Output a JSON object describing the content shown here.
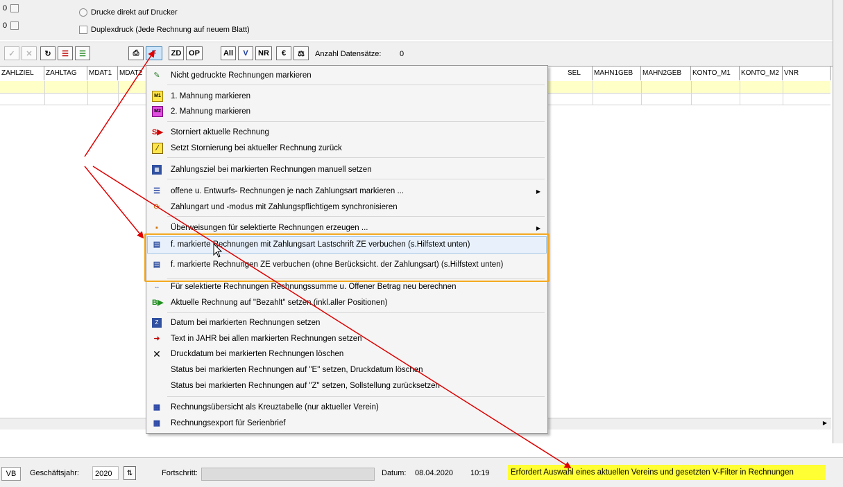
{
  "options": {
    "row1_num": "0",
    "row2_num": "0",
    "print_direct": "Drucke direkt auf Drucker",
    "duplex": "Duplexdruck (Jede Rechnung auf neuem Blatt)"
  },
  "toolbar": {
    "zd": "ZD",
    "op": "OP",
    "all": "All",
    "v": "V",
    "nr": "NR",
    "count_label": "Anzahl Datensätze:",
    "count_value": "0"
  },
  "grid": {
    "columns_left": [
      "ZAHLZIEL",
      "ZAHLTAG",
      "MDAT1",
      "MDAT2"
    ],
    "columns_right": [
      "SEL",
      "MAHN1GEB",
      "MAHN2GEB",
      "KONTO_M1",
      "KONTO_M2",
      "VNR"
    ]
  },
  "menu": {
    "items": [
      {
        "label": "Nicht gedruckte Rechnungen markieren",
        "icon": "mark-unprinted-icon"
      },
      {
        "label": "1. Mahnung markieren",
        "icon": "reminder1-icon"
      },
      {
        "label": "2. Mahnung markieren",
        "icon": "reminder2-icon"
      },
      {
        "label": "Storniert aktuelle Rechnung",
        "icon": "cancel-invoice-icon"
      },
      {
        "label": "Setzt Stornierung bei aktueller Rechnung zurück",
        "icon": "reset-cancel-icon"
      },
      {
        "label": "Zahlungsziel bei markierten Rechnungen manuell setzen",
        "icon": "calendar-icon"
      },
      {
        "label": "offene u. Entwurfs- Rechnungen je nach Zahlungsart markieren ...",
        "icon": "list-icon"
      },
      {
        "label": "Zahlungart und -modus mit Zahlungspflichtigem synchronisieren",
        "icon": "sync-icon"
      },
      {
        "label": "Überweisungen für selektierte Rechnungen erzeugen ...",
        "icon": "transfer-icon"
      },
      {
        "label": "f. markierte Rechnungen mit Zahlungsart Lastschrift ZE verbuchen (s.Hilfstext unten)",
        "icon": "book-payment-icon"
      },
      {
        "label": "f. markierte Rechnungen ZE verbuchen (ohne Berücksicht. der Zahlungsart) (s.Hilfstext unten)",
        "icon": "book-payment-icon"
      },
      {
        "label": "Für selektierte Rechnungen Rechnungssumme u. Offener Betrag neu berechnen",
        "icon": "recalc-icon"
      },
      {
        "label": "Aktuelle Rechnung auf \"Bezahlt\" setzen (inkl.aller Positionen)",
        "icon": "paid-icon"
      },
      {
        "label": "Datum bei markierten Rechnungen setzen",
        "icon": "date-icon"
      },
      {
        "label": "Text in JAHR bei allen markierten Rechnungen setzen",
        "icon": "text-year-icon"
      },
      {
        "label": "Druckdatum bei markierten Rechnungen löschen",
        "icon": "delete-x-icon"
      },
      {
        "label": "Status bei markierten Rechnungen auf \"E\" setzen, Druckdatum löschen",
        "icon": ""
      },
      {
        "label": "Status bei markierten Rechnungen auf \"Z\" setzen, Sollstellung zurücksetzen",
        "icon": ""
      },
      {
        "label": "Rechnungsübersicht als Kreuztabelle (nur aktueller Verein)",
        "icon": "table-icon"
      },
      {
        "label": "Rechnungsexport für Serienbrief",
        "icon": "table-icon"
      }
    ]
  },
  "status": {
    "vb": "VB",
    "year_label": "Geschäftsjahr:",
    "year_value": "2020",
    "progress_label": "Fortschritt:",
    "date_label": "Datum:",
    "date_value": "08.04.2020",
    "time_value": "10:19",
    "hint": "Erfordert Auswahl eines aktuellen Vereins und  gesetzten V-Filter in Rechnungen"
  },
  "colors": {
    "highlight_frame": "#f4a820",
    "hint_bg": "#ffff33",
    "annotation_arrow": "#e00000",
    "row_yellow": "#ffffc8"
  }
}
